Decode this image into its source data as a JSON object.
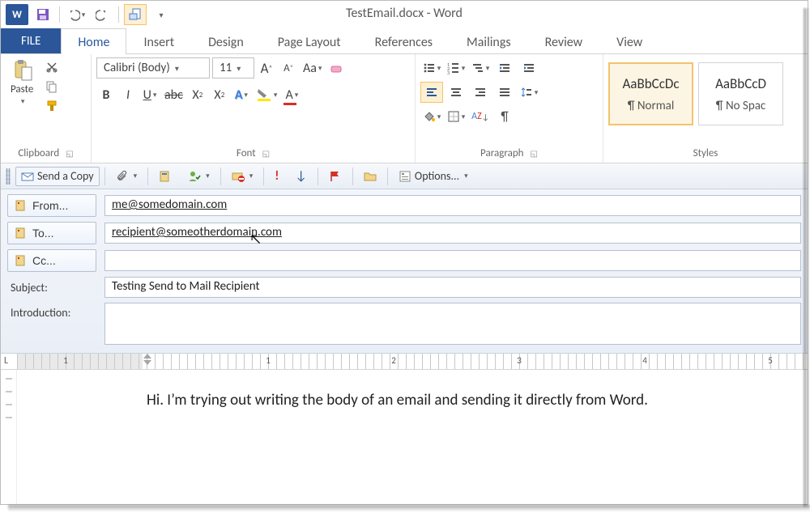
{
  "title": "TestEmail.docx - Word",
  "tabs": {
    "file": "FILE",
    "list": [
      "Home",
      "Insert",
      "Design",
      "Page Layout",
      "References",
      "Mailings",
      "Review",
      "View"
    ],
    "active": "Home"
  },
  "ribbon": {
    "clipboard": {
      "paste": "Paste",
      "label": "Clipboard"
    },
    "font": {
      "name": "Calibri (Body)",
      "size": "11",
      "label": "Font"
    },
    "paragraph": {
      "label": "Paragraph"
    },
    "styles": {
      "label": "Styles",
      "items": [
        {
          "sample": "AaBbCcDc",
          "name": "¶ Normal"
        },
        {
          "sample": "AaBbCcD",
          "name": "¶ No Spac"
        }
      ]
    }
  },
  "emailBar": {
    "send": "Send a Copy",
    "options": "Options..."
  },
  "fields": {
    "fromLabel": "From...",
    "from": "me@somedomain.com",
    "toLabel": "To...",
    "to": "recipient@someotherdomain.com",
    "ccLabel": "Cc...",
    "cc": "",
    "subjectLabel": "Subject:",
    "subject": "Testing Send to Mail Recipient",
    "introLabel": "Introduction:",
    "intro": ""
  },
  "ruler": {
    "L": "L",
    "nums": [
      "1",
      "1",
      "2",
      "3",
      "4",
      "5"
    ]
  },
  "body": "Hi. I’m trying out writing the body of an email and sending it directly from Word."
}
